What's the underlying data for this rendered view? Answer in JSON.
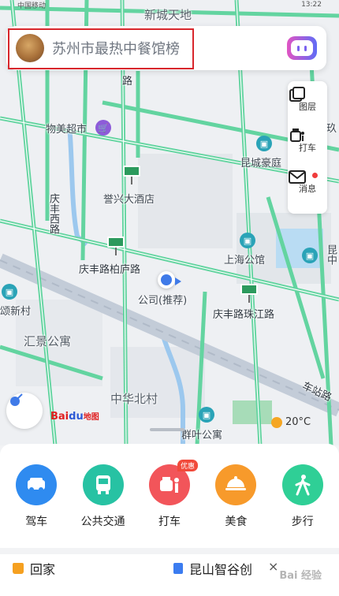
{
  "status_bar": {
    "carrier": "中国移动",
    "time": "13:22"
  },
  "search": {
    "query_text": "苏州市最热中餐馆榜",
    "avatar": "user-avatar-dog",
    "voice_icon": "voice-assistant-icon"
  },
  "side_tools": [
    {
      "label": "图层",
      "icon": "layers-icon"
    },
    {
      "label": "打车",
      "icon": "taxi-icon"
    },
    {
      "label": "消息",
      "icon": "mail-icon",
      "has_dot": true
    }
  ],
  "map_labels": {
    "xincheng": "新城天地",
    "road_lu": "路",
    "wumei": "物美超市",
    "kunchenghaoting": "昆城豪庭",
    "yuxing_hotel": "誉兴大酒店",
    "qingfeng_xilu": "庆丰西路",
    "qingfeng_bailu": "庆丰路柏庐路",
    "shanghai_gongguan": "上海公馆",
    "kun_partial": "昆中",
    "company": "公司(推荐)",
    "qingfeng_zhujiang": "庆丰路珠江路",
    "xinxin_cun": "颂新村",
    "huijing": "汇景公寓",
    "zhonghua_beicun": "中华北村",
    "chezhan_lu": "车站路",
    "qunye": "群叶公寓",
    "ying_partial": "英",
    "jiu_partial": "玖"
  },
  "map_branding": {
    "bai": "Bai",
    "du": "du",
    "map": "地图"
  },
  "weather": {
    "temp": "20°C",
    "icon": "partly-sunny-icon"
  },
  "shortcuts": [
    {
      "label": "驾车",
      "icon": "car-icon",
      "color": "#2f8bf0"
    },
    {
      "label": "公共交通",
      "icon": "bus-icon",
      "color": "#27c2a3"
    },
    {
      "label": "打车",
      "icon": "taxi-person-icon",
      "color": "#f2555a",
      "badge": "优惠"
    },
    {
      "label": "美食",
      "icon": "food-dish-icon",
      "color": "#f79a2b"
    },
    {
      "label": "步行",
      "icon": "walk-icon",
      "color": "#2fcf96"
    }
  ],
  "favorites": {
    "home": "回家",
    "company_place": "昆山智谷创",
    "close": "×"
  },
  "watermark": "Bai 经验"
}
